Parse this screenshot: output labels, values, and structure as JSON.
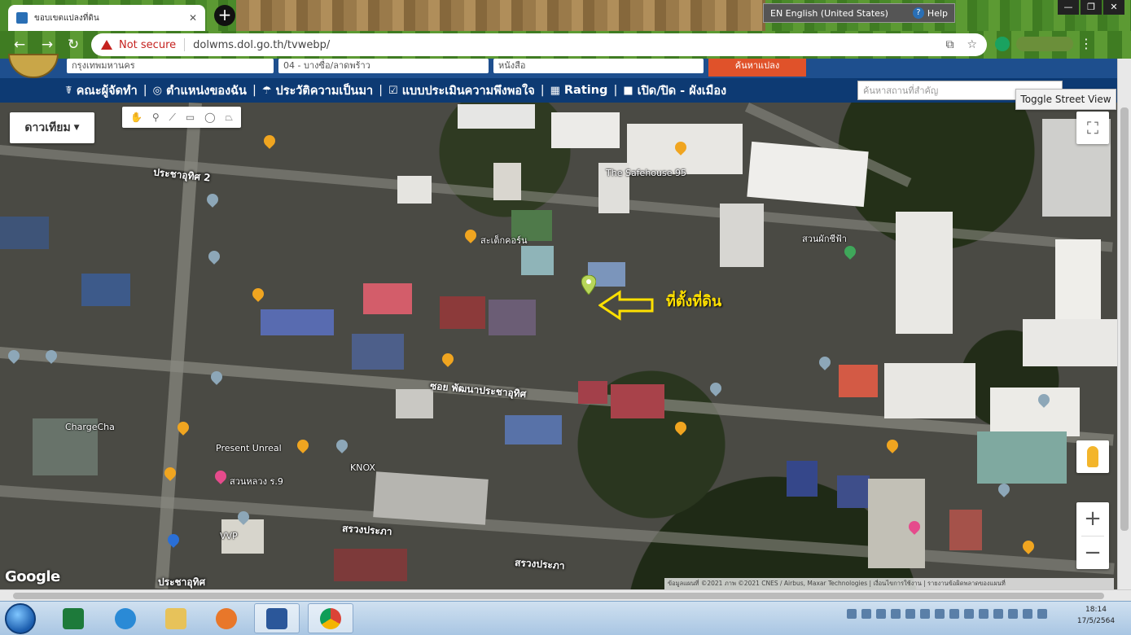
{
  "browser": {
    "tab_title": "ขอบเขตแปลงที่ดิน",
    "url": "dolwms.dol.go.th/tvwebp/",
    "security": "Not secure",
    "language": "EN English (United States)",
    "help": "Help"
  },
  "site": {
    "selects": [
      "กรุงเทพมหานคร",
      "04 - บางซื่อ/ลาดพร้าว",
      "หนังสือ"
    ],
    "search_button": "ค้นหาแปลง",
    "menu": [
      {
        "icon": "person-icon",
        "glyph": "☤",
        "label": "คณะผู้จัดทำ"
      },
      {
        "icon": "location-icon",
        "glyph": "◎",
        "label": "ตำแหน่งของฉัน"
      },
      {
        "icon": "history-icon",
        "glyph": "☂",
        "label": "ประวัติความเป็นมา"
      },
      {
        "icon": "survey-icon",
        "glyph": "☑",
        "label": "แบบประเมินความพึงพอใจ"
      },
      {
        "icon": "rating-icon",
        "glyph": "▦",
        "label": "Rating"
      },
      {
        "icon": "toggle-icon",
        "glyph": "■",
        "label": "เปิด/ปิด - ผังเมือง"
      }
    ],
    "place_search_placeholder": "ค้นหาสถานที่สำคัญ",
    "toggle_street_view": "Toggle Street View"
  },
  "map": {
    "map_type": "ดาวเทียม",
    "callout": "ที่ตั้งที่ดิน",
    "logo": "Google",
    "attribution": "ข้อมูลแผนที่ ©2021 ภาพ ©2021 CNES / Airbus, Maxar Technologies | เงื่อนไขการใช้งาน | รายงานข้อผิดพลาดของแผนที่",
    "labels": [
      {
        "text": "The Safehouse 95",
        "kind": "poi"
      },
      {
        "text": "ประชาอุทิศ 2",
        "kind": "street"
      },
      {
        "text": "ซอย พัฒนาประชาอุทิศ",
        "kind": "street"
      },
      {
        "text": "ChargeCha",
        "kind": "poi"
      },
      {
        "text": "Present Unreal",
        "kind": "poi"
      },
      {
        "text": "สวนหลวง ร.9",
        "kind": "poi"
      },
      {
        "text": "KNOX",
        "kind": "poi"
      },
      {
        "text": "VVP",
        "kind": "poi"
      },
      {
        "text": "สรวงประภา",
        "kind": "street"
      },
      {
        "text": "สรวงประภา",
        "kind": "street"
      },
      {
        "text": "ประชาอุทิศ",
        "kind": "street"
      },
      {
        "text": "สะเต็กคอร์น",
        "kind": "poi"
      },
      {
        "text": "สวนผักชีฟ้า",
        "kind": "poi"
      }
    ]
  },
  "taskbar": {
    "time": "18:14",
    "date": "17/5/2564"
  }
}
